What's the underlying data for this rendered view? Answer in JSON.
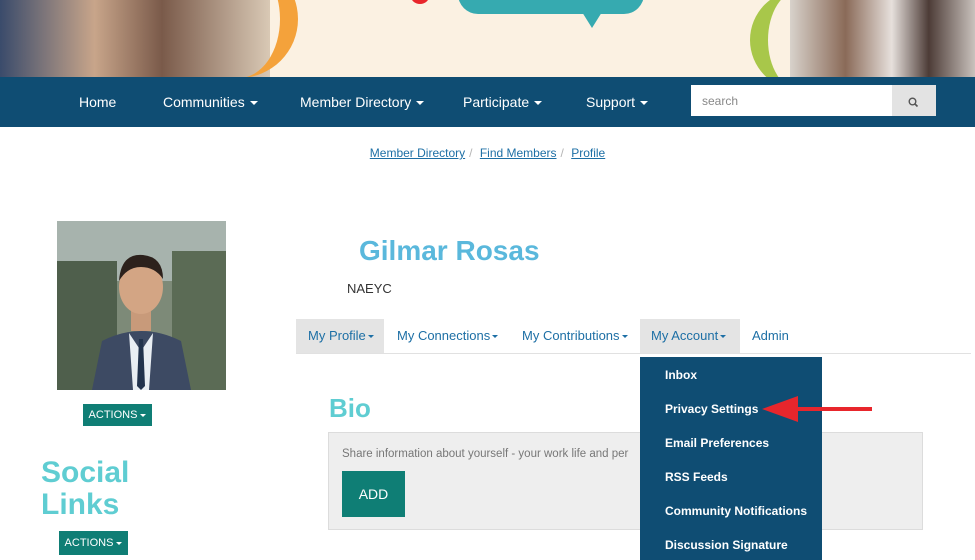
{
  "nav": {
    "items": [
      {
        "label": "Home"
      },
      {
        "label": "Communities"
      },
      {
        "label": "Member Directory"
      },
      {
        "label": "Participate"
      },
      {
        "label": "Support"
      }
    ],
    "search_placeholder": "search"
  },
  "breadcrumb": [
    "Member Directory",
    "Find Members",
    "Profile"
  ],
  "profile": {
    "name": "Gilmar Rosas",
    "organization": "NAEYC",
    "actions_label": "ACTIONS",
    "social_links_title": "Social Links"
  },
  "tabs": [
    {
      "label": "My Profile"
    },
    {
      "label": "My Connections"
    },
    {
      "label": "My Contributions"
    },
    {
      "label": "My Account"
    },
    {
      "label": "Admin"
    }
  ],
  "bio": {
    "title": "Bio",
    "placeholder_text": "Share information about yourself - your work life and per",
    "add_label": "ADD"
  },
  "account_menu": {
    "items": [
      {
        "label": "Inbox"
      },
      {
        "label": "Privacy Settings"
      },
      {
        "label": "Email Preferences"
      },
      {
        "label": "RSS Feeds"
      },
      {
        "label": "Community Notifications"
      },
      {
        "label": "Discussion Signature"
      }
    ]
  },
  "colors": {
    "nav_bg": "#0f4d73",
    "accent_teal": "#0f7e75",
    "heading_teal": "#5fcdd2",
    "name_blue": "#5ab8dc",
    "link_blue": "#1d6fa5",
    "annotation_red": "#e8262c"
  }
}
